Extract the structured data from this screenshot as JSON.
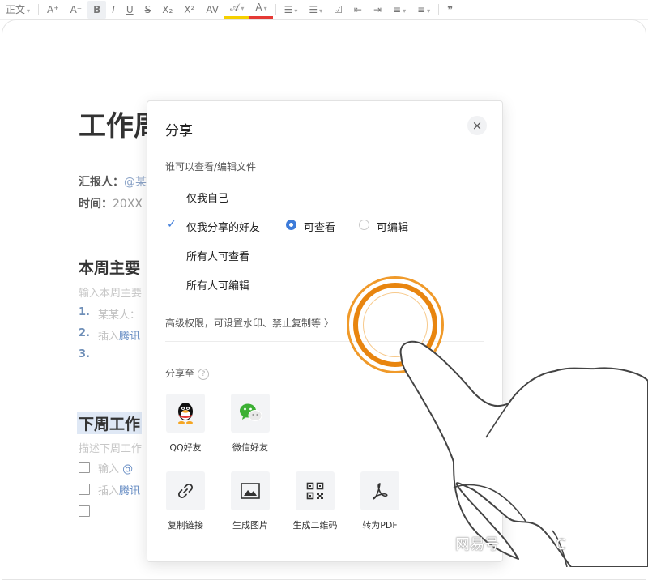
{
  "toolbar": {
    "items": [
      "正文",
      "A⁺",
      "A⁻",
      "B",
      "I",
      "U",
      "S",
      "X₂",
      "X²",
      "AV",
      "𝒜",
      "A"
    ],
    "list_icons": [
      "bullet-list-icon",
      "numbered-list-icon",
      "checklist-icon",
      "outdent-icon",
      "indent-icon",
      "align-icon",
      "line-spacing-icon",
      "quote-icon"
    ],
    "quote": "❞",
    "highlight_color": "#f5d000",
    "font_color": "#e53935"
  },
  "document": {
    "title_partial": "工作周",
    "reporter_label": "汇报人：",
    "reporter_value": "@某",
    "time_label": "时间：",
    "time_value": "20XX",
    "section1_heading": "本周主要",
    "section1_placeholder": "输入本周主要",
    "list1": [
      {
        "num": "1.",
        "text": "某某人："
      },
      {
        "num": "2.",
        "text": "插入",
        "link": "腾讯"
      },
      {
        "num": "3.",
        "text": ""
      }
    ],
    "section2_heading": "下周工作",
    "section2_placeholder": "描述下周工作",
    "todos": [
      {
        "text": "输入",
        "link": "@"
      },
      {
        "text": "插入",
        "link": "腾讯"
      },
      {
        "text": ""
      }
    ]
  },
  "dialog": {
    "title": "分享",
    "close": "×",
    "permission_label": "谁可以查看/编辑文件",
    "options": [
      "仅我自己",
      "仅我分享的好友",
      "所有人可查看",
      "所有人可编辑"
    ],
    "selected_option": "仅我分享的好友",
    "check_mark": "✓",
    "friend_modes": [
      "可查看",
      "可编辑"
    ],
    "selected_mode": "可查看",
    "advanced": "高级权限，可设置水印、禁止复制等 〉",
    "share_to_label": "分享至",
    "help": "?",
    "targets": [
      "QQ好友",
      "微信好友"
    ],
    "actions": [
      "复制链接",
      "生成图片",
      "生成二维码",
      "转为PDF"
    ]
  },
  "overlay": {
    "watermark": "网易号",
    "watermark_tail": "C",
    "ring_color": "#e8850f"
  }
}
